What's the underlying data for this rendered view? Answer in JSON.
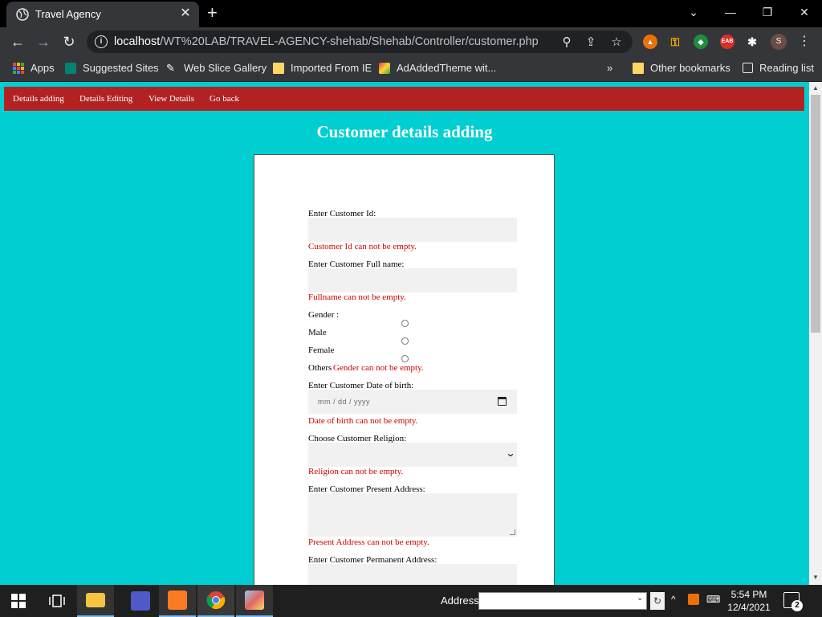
{
  "browser": {
    "tab_title": "Travel Agency",
    "tab_close": "✕",
    "new_tab": "+",
    "url_host": "localhost",
    "url_path": "/WT%20LAB/TRAVEL-AGENCY-shehab/Shehab/Controller/customer.php",
    "profile_initial": "S",
    "ext_badge": "EAB",
    "window_controls": [
      "⌄",
      "—",
      "❐",
      "✕"
    ]
  },
  "bookmarks": {
    "apps": "Apps",
    "suggested_sites": "Suggested Sites",
    "web_slice_gallery": "Web Slice Gallery",
    "imported_from_ie": "Imported From IE",
    "adaddedtheme": "AdAddedTheme wit...",
    "overflow": "»",
    "other_bookmarks": "Other bookmarks",
    "reading_list": "Reading list"
  },
  "menu": {
    "details_adding": "Details adding",
    "details_editing": "Details Editing",
    "view_details": "View Details",
    "go_back": "Go back"
  },
  "page": {
    "heading": "Customer details adding"
  },
  "form": {
    "customer_id_label": "Enter Customer Id:",
    "customer_id_error": "Customer Id can not be empty.",
    "fullname_label": "Enter Customer Full name:",
    "fullname_error": "Fullname can not be empty.",
    "gender_label": "Gender :",
    "gender_options": [
      "Male",
      "Female",
      "Others"
    ],
    "gender_error": "Gender can not be empty.",
    "dob_label": "Enter Customer Date of birth:",
    "dob_placeholder": "mm / dd / yyyy",
    "dob_error": "Date of birth can not be empty.",
    "religion_label": "Choose Customer Religion:",
    "religion_error": "Religion can not be empty.",
    "present_address_label": "Enter Customer Present Address:",
    "present_address_error": "Present Address can not be empty.",
    "permanent_address_label": "Enter Customer Permanent Address:"
  },
  "taskbar": {
    "address_label": "Address",
    "time": "5:54 PM",
    "date": "12/4/2021",
    "notification_count": "2"
  },
  "colors": {
    "page_background": "#00ced1",
    "menu_bar": "#b22222",
    "error_text": "#d10000"
  }
}
